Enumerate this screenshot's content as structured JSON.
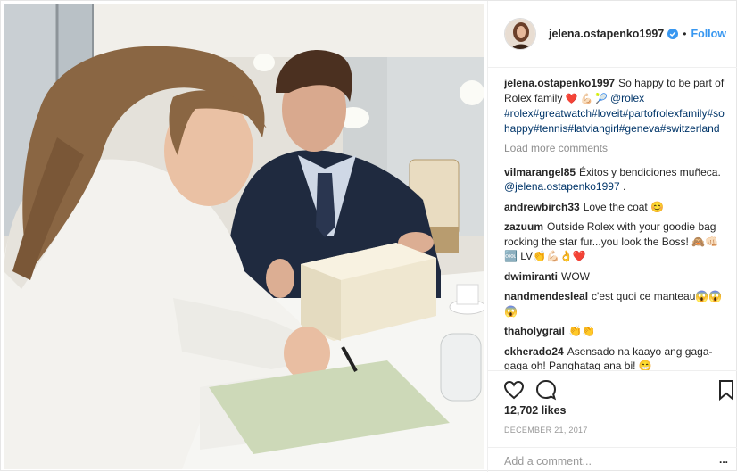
{
  "post": {
    "username": "jelena.ostapenko1997",
    "follow_label": "Follow",
    "separator": "•",
    "caption": {
      "username": "jelena.ostapenko1997",
      "text_before": "So happy to be part of Rolex family ",
      "emojis": "❤️ 💪🏻 🎾 ",
      "mention": "@rolex",
      "hashtags": "#rolex#greatwatch#loveit#partofrolexfamily#sohappy#tennis#latviangirl#geneva#switzerland"
    },
    "load_more_label": "Load more comments",
    "comments": [
      {
        "user": "vilmarangel85",
        "text": "Éxitos y bendiciones muñeca. ",
        "mention": "@jelena.ostapenko1997",
        "suffix": " ."
      },
      {
        "user": "andrewbirch33",
        "text": "Love the coat 😊",
        "mention": "",
        "suffix": ""
      },
      {
        "user": "zazuum",
        "text": "Outside Rolex with your goodie bag rocking the star fur...you look the Boss! 🙈👊🏻 🆒 LV👏💪🏻👌❤️",
        "mention": "",
        "suffix": ""
      },
      {
        "user": "dwimiranti",
        "text": "WOW",
        "mention": "",
        "suffix": ""
      },
      {
        "user": "nandmendesleal",
        "text": "c'est quoi ce manteau😱😱😱",
        "mention": "",
        "suffix": ""
      },
      {
        "user": "thaholygrail",
        "text": "👏👏",
        "mention": "",
        "suffix": ""
      },
      {
        "user": "ckherado24",
        "text": "Asensado na kaayo ang gaga-gaga oh! Panghatag ana bi! 😁",
        "mention": "",
        "suffix": ""
      }
    ],
    "likes": "12,702 likes",
    "date": "DECEMBER 21, 2017",
    "add_comment_placeholder": "Add a comment...",
    "more_label": "..."
  },
  "icons": {
    "like": "heart-icon",
    "comment": "comment-icon",
    "save": "bookmark-icon",
    "verified": "verified-badge-icon",
    "more": "more-options-icon"
  },
  "colors": {
    "follow": "#3897f0",
    "verified": "#3897f0",
    "hashtag": "#003569",
    "muted": "#8e8e8e"
  }
}
